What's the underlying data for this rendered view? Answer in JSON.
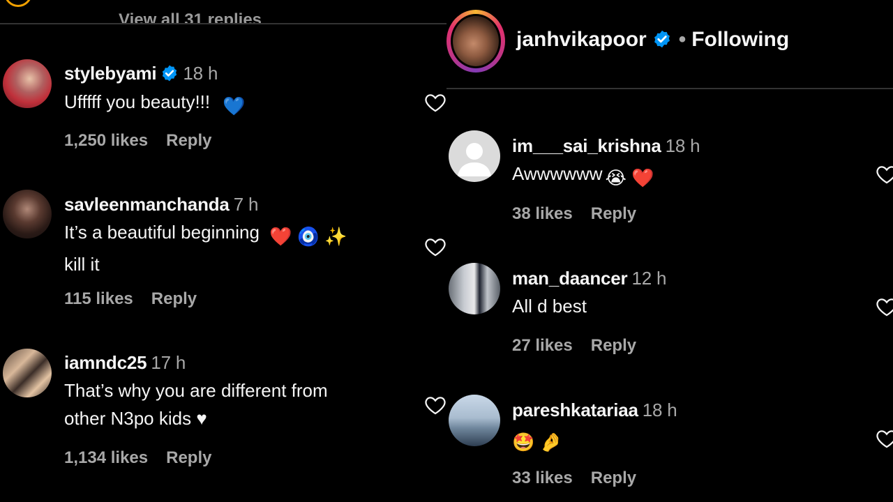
{
  "left": {
    "view_replies": "View all 31 replies",
    "comments": [
      {
        "username": "stylebyami",
        "verified": true,
        "time": "18 h",
        "text": "Ufffff you beauty!!!",
        "emoji": "💙",
        "likes": "1,250 likes",
        "reply": "Reply"
      },
      {
        "username": "savleenmanchanda",
        "verified": false,
        "time": "7 h",
        "text_line1": "It’s a beautiful beginning",
        "text_line2": "kill it",
        "emoji": "❤️ 🧿 ✨",
        "likes": "115 likes",
        "reply": "Reply"
      },
      {
        "username": "iamndc25",
        "verified": false,
        "time": "17 h",
        "text_line1": "That’s why you are different from",
        "text_line2": "other N3po kids ♥",
        "likes": "1,134 likes",
        "reply": "Reply"
      }
    ]
  },
  "right": {
    "header": {
      "username": "janhvikapoor",
      "verified": true,
      "separator": "•",
      "follow_status": "Following"
    },
    "comments": [
      {
        "username": "im___sai_krishna",
        "time": "18 h",
        "text": "Awwwwww",
        "emoji": "😭 ❤️",
        "likes": "38 likes",
        "reply": "Reply"
      },
      {
        "username": "man_daancer",
        "time": "12 h",
        "text": "All d best",
        "likes": "27 likes",
        "reply": "Reply"
      },
      {
        "username": "pareshkatariaa",
        "time": "18 h",
        "emoji": "🤩 🤌",
        "likes": "33 likes",
        "reply": "Reply"
      }
    ]
  },
  "colors": {
    "background": "#000000",
    "text": "#f5f5f5",
    "muted": "#a8a8a8",
    "verified": "#0095f6",
    "heart_red": "#e0212a"
  },
  "icons": [
    "verified-badge-icon",
    "heart-icon"
  ]
}
